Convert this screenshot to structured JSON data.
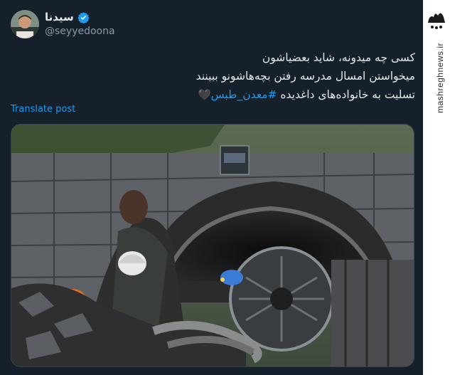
{
  "author": {
    "display_name": "سیدنا",
    "handle": "@seyyedoona",
    "verified": true
  },
  "tweet": {
    "line1": "کسی چه میدونه، شاید بعضیاشون",
    "line2": "میخواستن امسال مدرسه رفتن بچه‌هاشونو ببینند",
    "line3_prefix": "تسلیت به خانواده‌های داغدیده ",
    "hashtag": "#معدن_طبس",
    "emoji": "🖤"
  },
  "translate_label": "Translate post",
  "watermark": {
    "logo_text": "مشرق",
    "url": "mashreghnews.ir"
  },
  "colors": {
    "background": "#15202b",
    "link": "#1d9bf0",
    "verified": "#1d9bf0"
  }
}
